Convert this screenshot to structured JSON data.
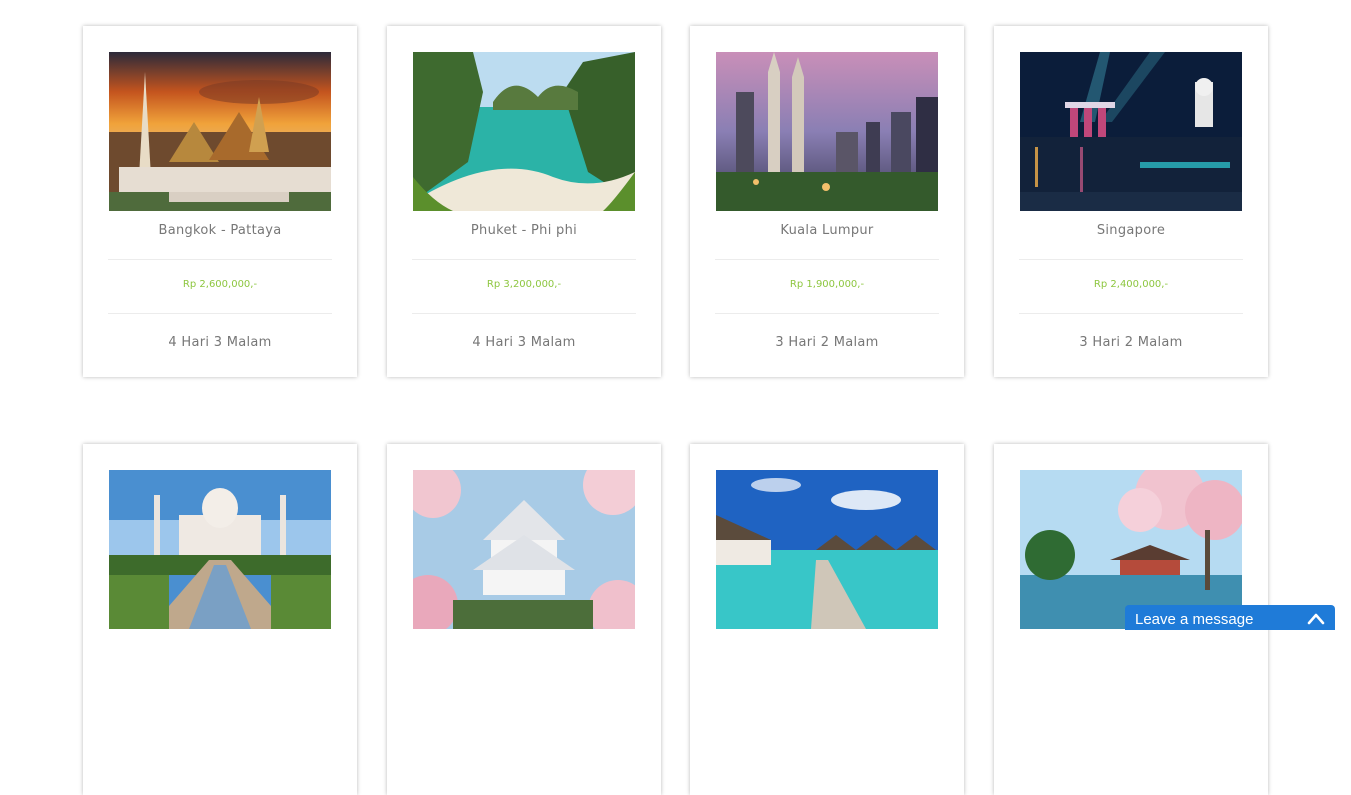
{
  "packages": [
    {
      "name": "Bangkok - Pattaya",
      "price": "Rp 2,600,000,-",
      "duration": "4 Hari 3 Malam",
      "image": "bangkok-temple-photo"
    },
    {
      "name": "Phuket - Phi phi",
      "price": "Rp 3,200,000,-",
      "duration": "4 Hari 3 Malam",
      "image": "phi-phi-bay-photo"
    },
    {
      "name": "Kuala Lumpur",
      "price": "Rp 1,900,000,-",
      "duration": "3 Hari 2 Malam",
      "image": "kuala-lumpur-skyline-photo"
    },
    {
      "name": "Singapore",
      "price": "Rp 2,400,000,-",
      "duration": "3 Hari 2 Malam",
      "image": "singapore-marina-photo"
    },
    {
      "name": "",
      "price": "",
      "duration": "",
      "image": "taj-mahal-photo"
    },
    {
      "name": "",
      "price": "",
      "duration": "",
      "image": "japan-castle-sakura-photo"
    },
    {
      "name": "",
      "price": "",
      "duration": "",
      "image": "maldives-villas-photo"
    },
    {
      "name": "",
      "price": "",
      "duration": "",
      "image": "korea-pavilion-sakura-photo"
    }
  ],
  "chat_widget": {
    "label": "Leave a message",
    "icon": "chevron-up-icon"
  },
  "colors": {
    "price": "#8dc63f",
    "text": "#777777",
    "chat": "#1f7bd8"
  }
}
